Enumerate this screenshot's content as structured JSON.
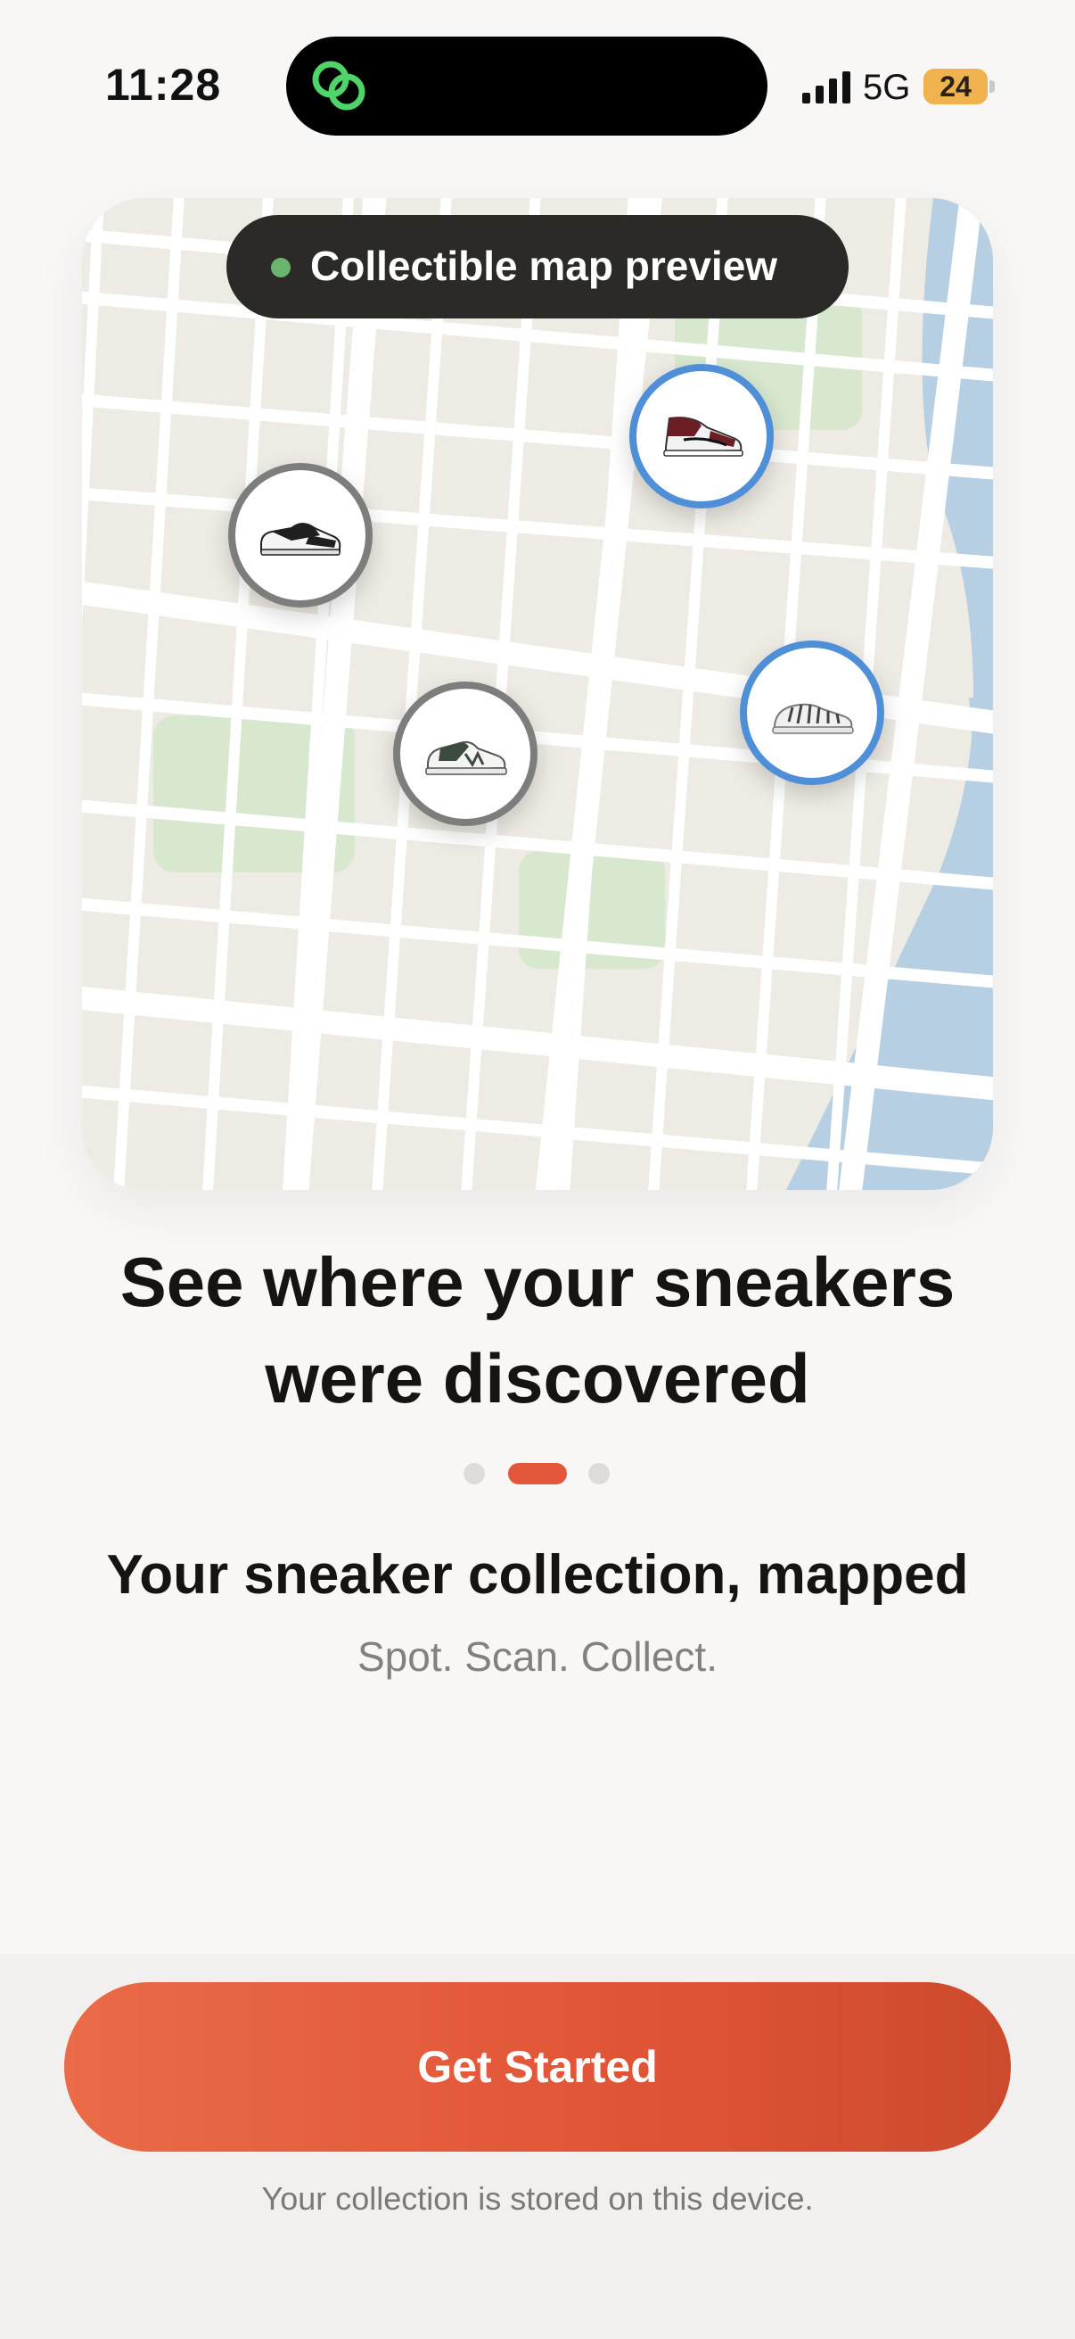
{
  "status_bar": {
    "time": "11:28",
    "network": "5G",
    "battery": "24",
    "island_icon": "link-rings-icon",
    "colors": {
      "island_icon": "#4fd46a",
      "battery": "#f0b24f"
    }
  },
  "map": {
    "badge_label": "Collectible map preview",
    "badge_dot_color": "#6bb46f",
    "pins": [
      {
        "name": "panda-dunk-pin",
        "icon": "sneaker-icon",
        "ring": "gray"
      },
      {
        "name": "jordan-1-pin",
        "icon": "sneaker-icon",
        "ring": "blue"
      },
      {
        "name": "new-balance-pin",
        "icon": "sneaker-icon",
        "ring": "gray"
      },
      {
        "name": "yeezy-zebra-pin",
        "icon": "sneaker-icon",
        "ring": "blue"
      }
    ],
    "colors": {
      "land": "#eeebe4",
      "streets": "#ffffff",
      "parks": "#d7e8cf",
      "river": "#b6cfe2"
    }
  },
  "onboarding": {
    "headline_line1": "See where your sneakers",
    "headline_line2": "were discovered",
    "page_indicator": {
      "total": 3,
      "active": 2
    },
    "subtitle": "Your sneaker collection, mapped",
    "tagline": "Spot. Scan. Collect."
  },
  "footer": {
    "cta_label": "Get Started",
    "cta_color": "#e05436",
    "note": "Your collection is stored on this device."
  }
}
